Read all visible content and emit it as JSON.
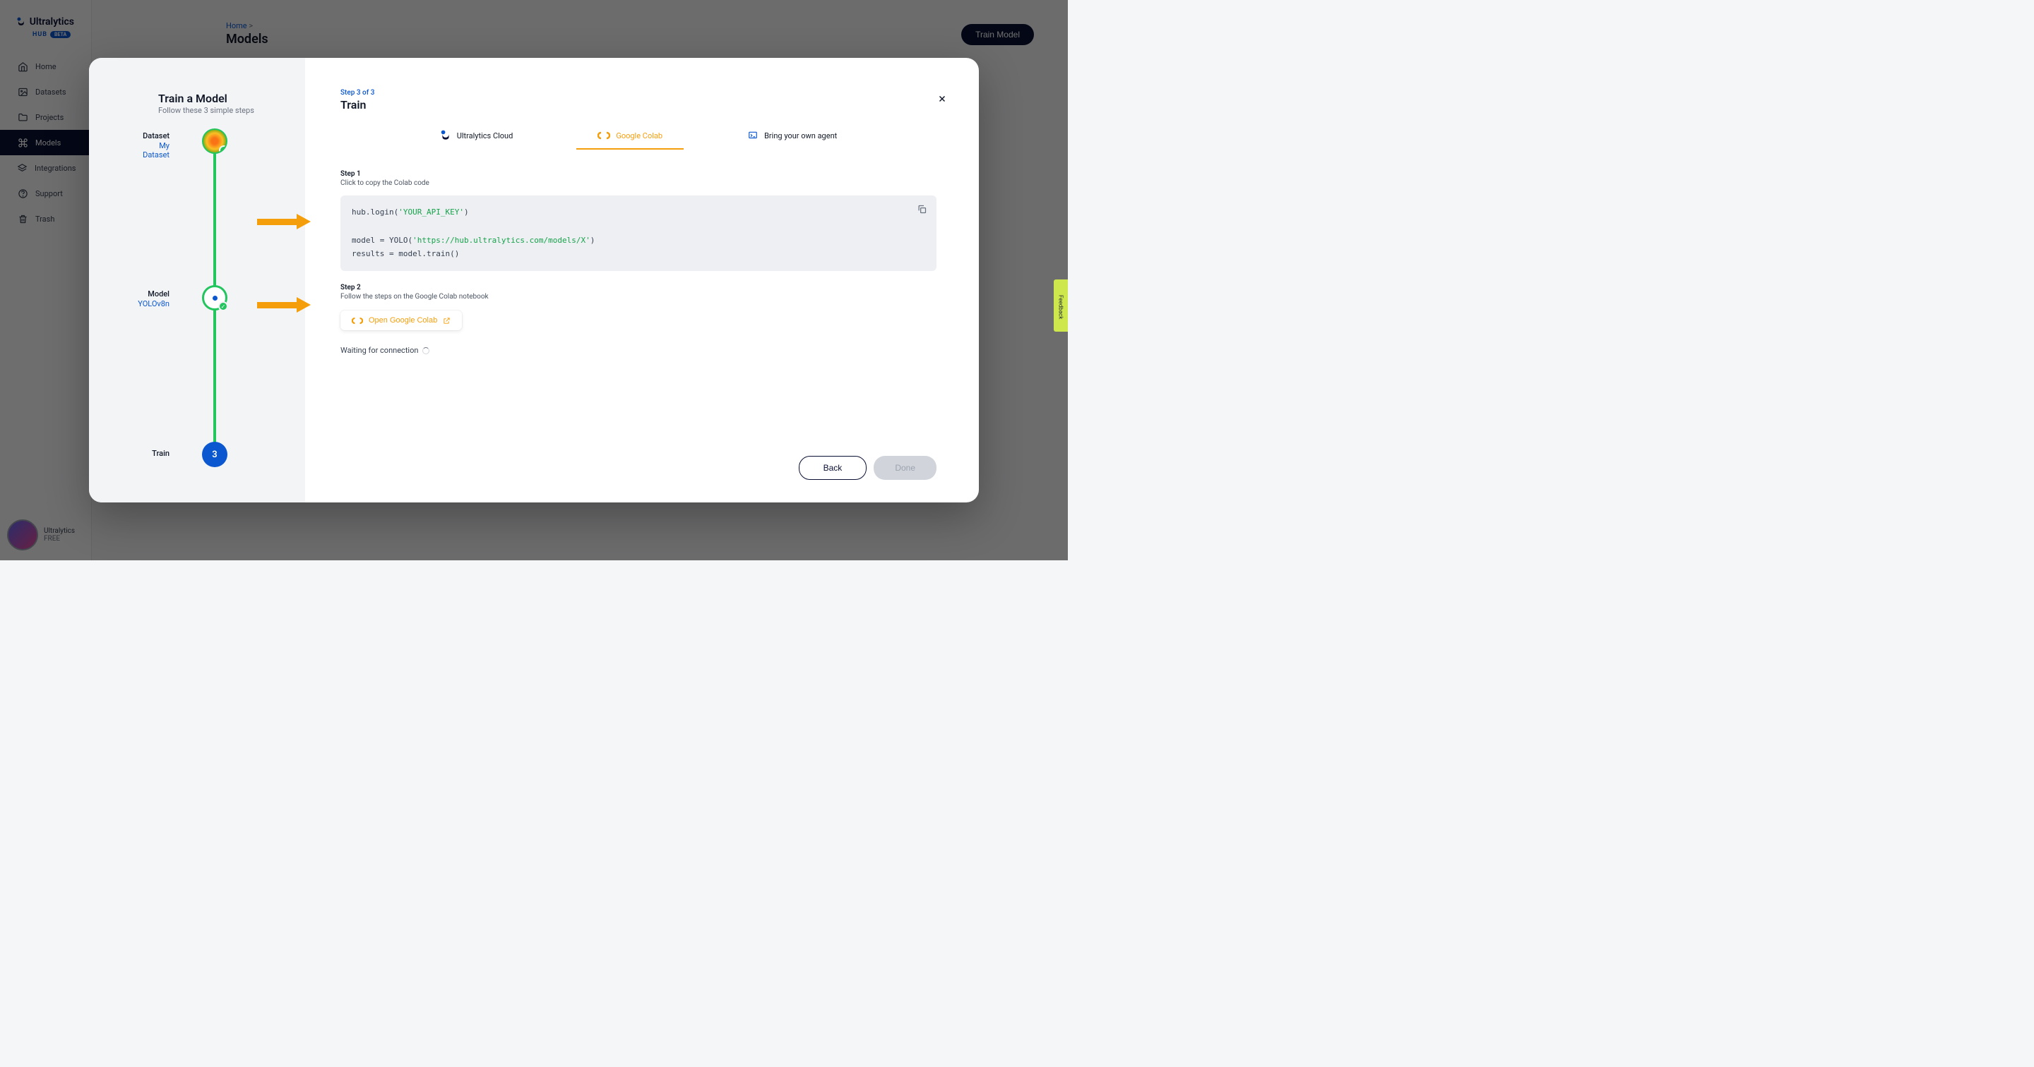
{
  "brand": {
    "name": "Ultralytics",
    "sub": "HUB",
    "badge": "BETA"
  },
  "sidebar": {
    "items": [
      {
        "label": "Home"
      },
      {
        "label": "Datasets"
      },
      {
        "label": "Projects"
      },
      {
        "label": "Models"
      },
      {
        "label": "Integrations"
      },
      {
        "label": "Support"
      },
      {
        "label": "Trash"
      }
    ]
  },
  "user": {
    "name": "Ultralytics",
    "plan": "FREE"
  },
  "topbar": {
    "breadcrumb_home": "Home",
    "breadcrumb_sep": ">",
    "title": "Models",
    "train_btn": "Train Model"
  },
  "modal": {
    "title": "Train a Model",
    "subtitle": "Follow these 3 simple steps",
    "steps": [
      {
        "label": "Dataset",
        "value": "My Dataset"
      },
      {
        "label": "Model",
        "value": "YOLOv8n"
      },
      {
        "label": "Train",
        "num": "3"
      }
    ],
    "eyebrow": "Step 3 of 3",
    "heading": "Train",
    "tabs": [
      {
        "label": "Ultralytics Cloud"
      },
      {
        "label": "Google Colab"
      },
      {
        "label": "Bring your own agent"
      }
    ],
    "s1_label": "Step 1",
    "s1_desc": "Click to copy the Colab code",
    "code_1a": "hub.login(",
    "code_1b": "'YOUR_API_KEY'",
    "code_1c": ")",
    "code_2a": "model = YOLO(",
    "code_2b": "'https://hub.ultralytics.com/models/X'",
    "code_2c": ")",
    "code_3": "results = model.train()",
    "s2_label": "Step 2",
    "s2_desc": "Follow the steps on the Google Colab notebook",
    "open_colab": "Open Google Colab",
    "waiting": "Waiting for connection",
    "back": "Back",
    "done": "Done"
  },
  "feedback": "Feedback"
}
